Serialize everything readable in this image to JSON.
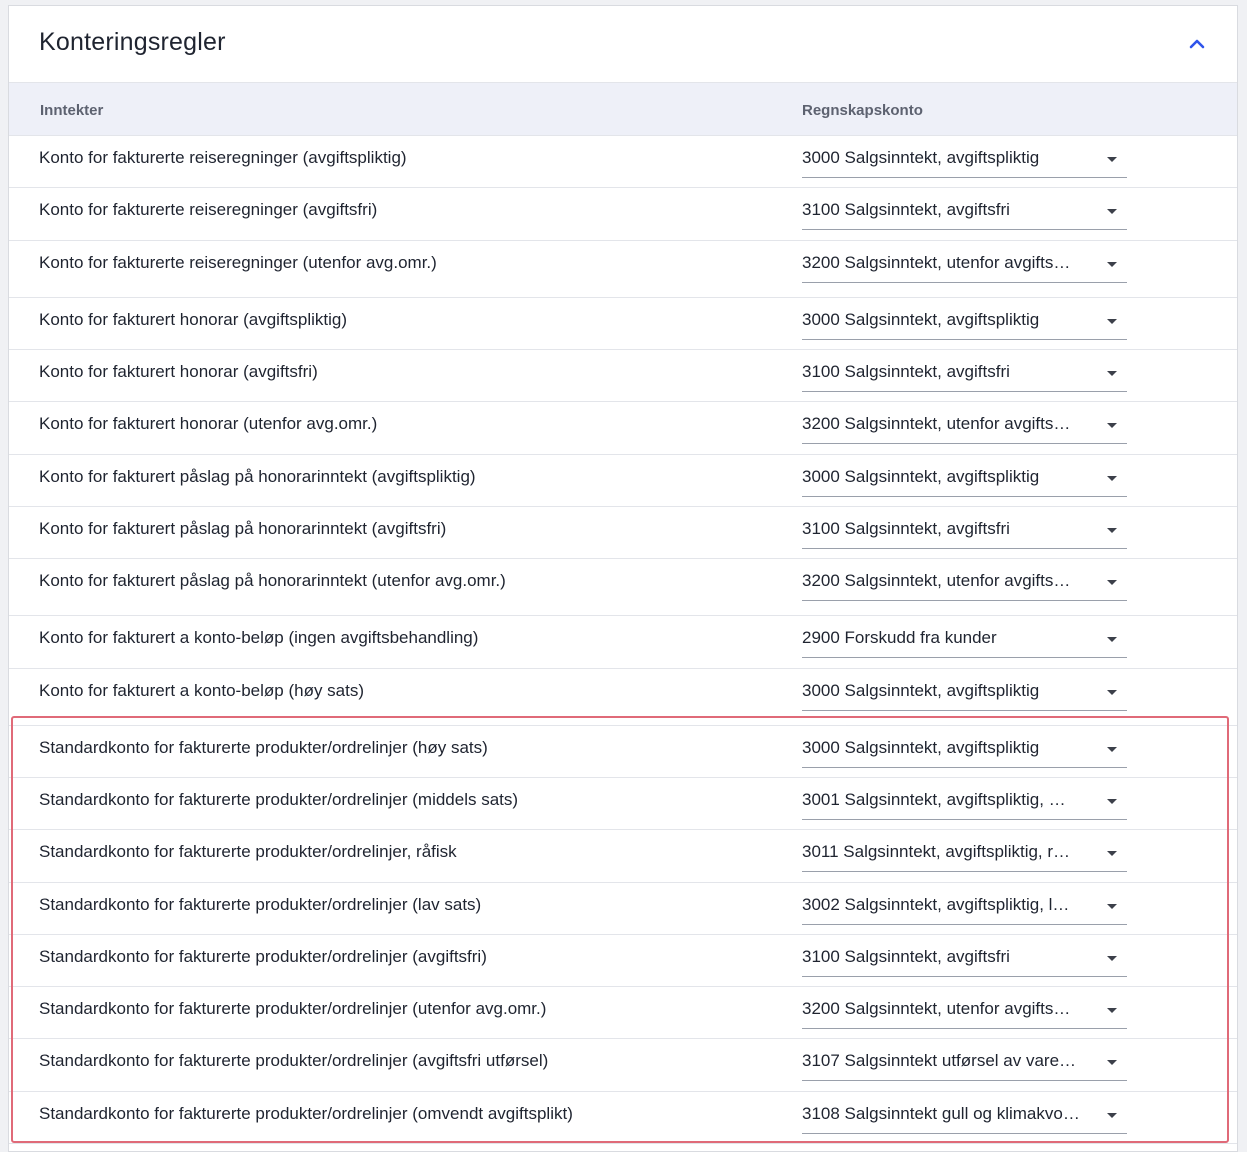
{
  "panel": {
    "title": "Konteringsregler",
    "collapse_icon": "chevron-up-icon",
    "accent_color": "#2f54eb",
    "highlight_color": "#e06a78"
  },
  "table": {
    "headers": {
      "left": "Inntekter",
      "right": "Regnskapskonto"
    },
    "rows": [
      {
        "label": "Konto for fakturerte reiseregninger (avgiftspliktig)",
        "account": "3000 Salgsinntekt, avgiftspliktig"
      },
      {
        "label": "Konto for fakturerte reiseregninger (avgiftsfri)",
        "account": "3100 Salgsinntekt, avgiftsfri"
      },
      {
        "label": "Konto for fakturerte reiseregninger (utenfor avg.omr.)",
        "account": "3200 Salgsinntekt, utenfor avgifts…"
      },
      {
        "label": "Konto for fakturert honorar (avgiftspliktig)",
        "account": "3000 Salgsinntekt, avgiftspliktig"
      },
      {
        "label": "Konto for fakturert honorar (avgiftsfri)",
        "account": "3100 Salgsinntekt, avgiftsfri"
      },
      {
        "label": "Konto for fakturert honorar (utenfor avg.omr.)",
        "account": "3200 Salgsinntekt, utenfor avgifts…"
      },
      {
        "label": "Konto for fakturert påslag på honorarinntekt (avgiftspliktig)",
        "account": "3000 Salgsinntekt, avgiftspliktig"
      },
      {
        "label": "Konto for fakturert påslag på honorarinntekt (avgiftsfri)",
        "account": "3100 Salgsinntekt, avgiftsfri"
      },
      {
        "label": "Konto for fakturert påslag på honorarinntekt (utenfor avg.omr.)",
        "account": "3200 Salgsinntekt, utenfor avgifts…"
      },
      {
        "label": "Konto for fakturert a konto-beløp (ingen avgiftsbehandling)",
        "account": "2900 Forskudd fra kunder"
      },
      {
        "label": "Konto for fakturert a konto-beløp (høy sats)",
        "account": "3000 Salgsinntekt, avgiftspliktig"
      },
      {
        "label": "Standardkonto for fakturerte produkter/ordrelinjer (høy sats)",
        "account": "3000 Salgsinntekt, avgiftspliktig"
      },
      {
        "label": "Standardkonto for fakturerte produkter/ordrelinjer (middels sats)",
        "account": "3001 Salgsinntekt, avgiftspliktig, …"
      },
      {
        "label": "Standardkonto for fakturerte produkter/ordrelinjer, råfisk",
        "account": "3011 Salgsinntekt, avgiftspliktig, r…"
      },
      {
        "label": "Standardkonto for fakturerte produkter/ordrelinjer (lav sats)",
        "account": "3002 Salgsinntekt, avgiftspliktig, l…"
      },
      {
        "label": "Standardkonto for fakturerte produkter/ordrelinjer (avgiftsfri)",
        "account": "3100 Salgsinntekt, avgiftsfri"
      },
      {
        "label": "Standardkonto for fakturerte produkter/ordrelinjer (utenfor avg.omr.)",
        "account": "3200 Salgsinntekt, utenfor avgifts…"
      },
      {
        "label": "Standardkonto for fakturerte produkter/ordrelinjer (avgiftsfri utførsel)",
        "account": "3107 Salgsinntekt utførsel av vare…"
      },
      {
        "label": "Standardkonto for fakturerte produkter/ordrelinjer (omvendt avgiftsplikt)",
        "account": "3108 Salgsinntekt gull og klimakvo…"
      }
    ]
  }
}
